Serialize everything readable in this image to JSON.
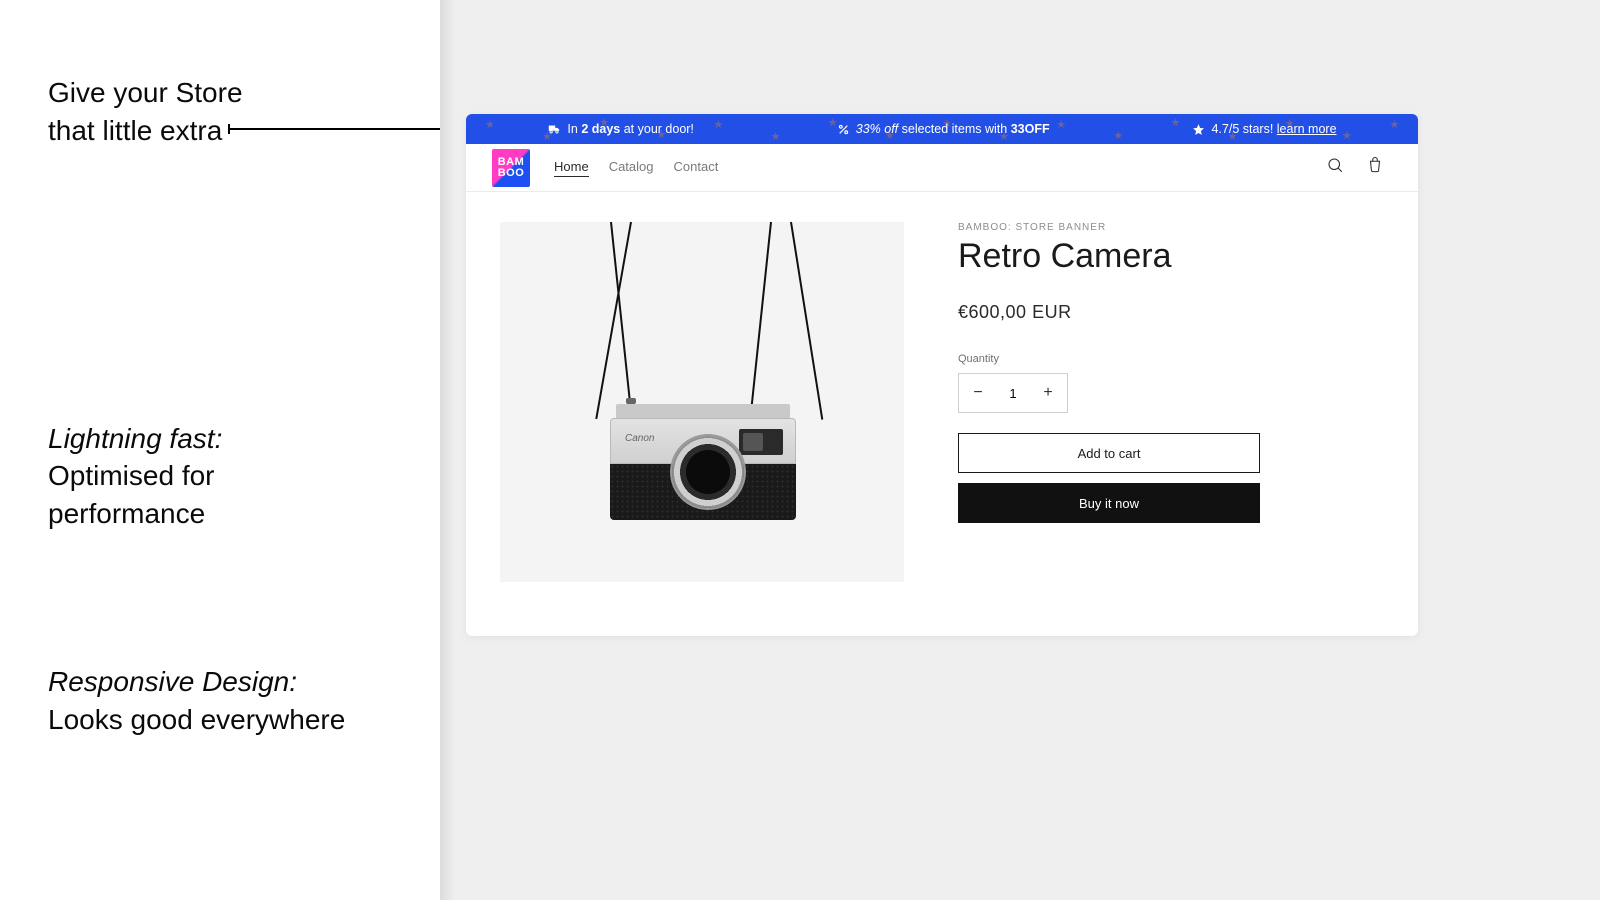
{
  "marketing": {
    "feature1_lead": "Give your Store",
    "feature1_body": "that little extra",
    "feature2_lead": "Lightning fast:",
    "feature2_body": "Optimised for performance",
    "feature3_lead": "Responsive Design:",
    "feature3_body": "Looks good everywhere"
  },
  "banner": {
    "item1_pre": "In ",
    "item1_bold": "2 days",
    "item1_post": " at your door!",
    "item2_em": "33% off",
    "item2_mid": " selected items with ",
    "item2_bold": "33OFF",
    "item3_text": "4.7/5 stars! ",
    "item3_link": "learn more"
  },
  "nav": {
    "logo_top": "BAM",
    "logo_bot": "BOO",
    "links": {
      "home": "Home",
      "catalog": "Catalog",
      "contact": "Contact"
    }
  },
  "product": {
    "vendor": "BAMBOO: STORE BANNER",
    "title": "Retro Camera",
    "price": "€600,00 EUR",
    "brand_on_camera": "Canon",
    "quantity_label": "Quantity",
    "quantity_value": "1",
    "add_to_cart": "Add to cart",
    "buy_now": "Buy it now"
  }
}
